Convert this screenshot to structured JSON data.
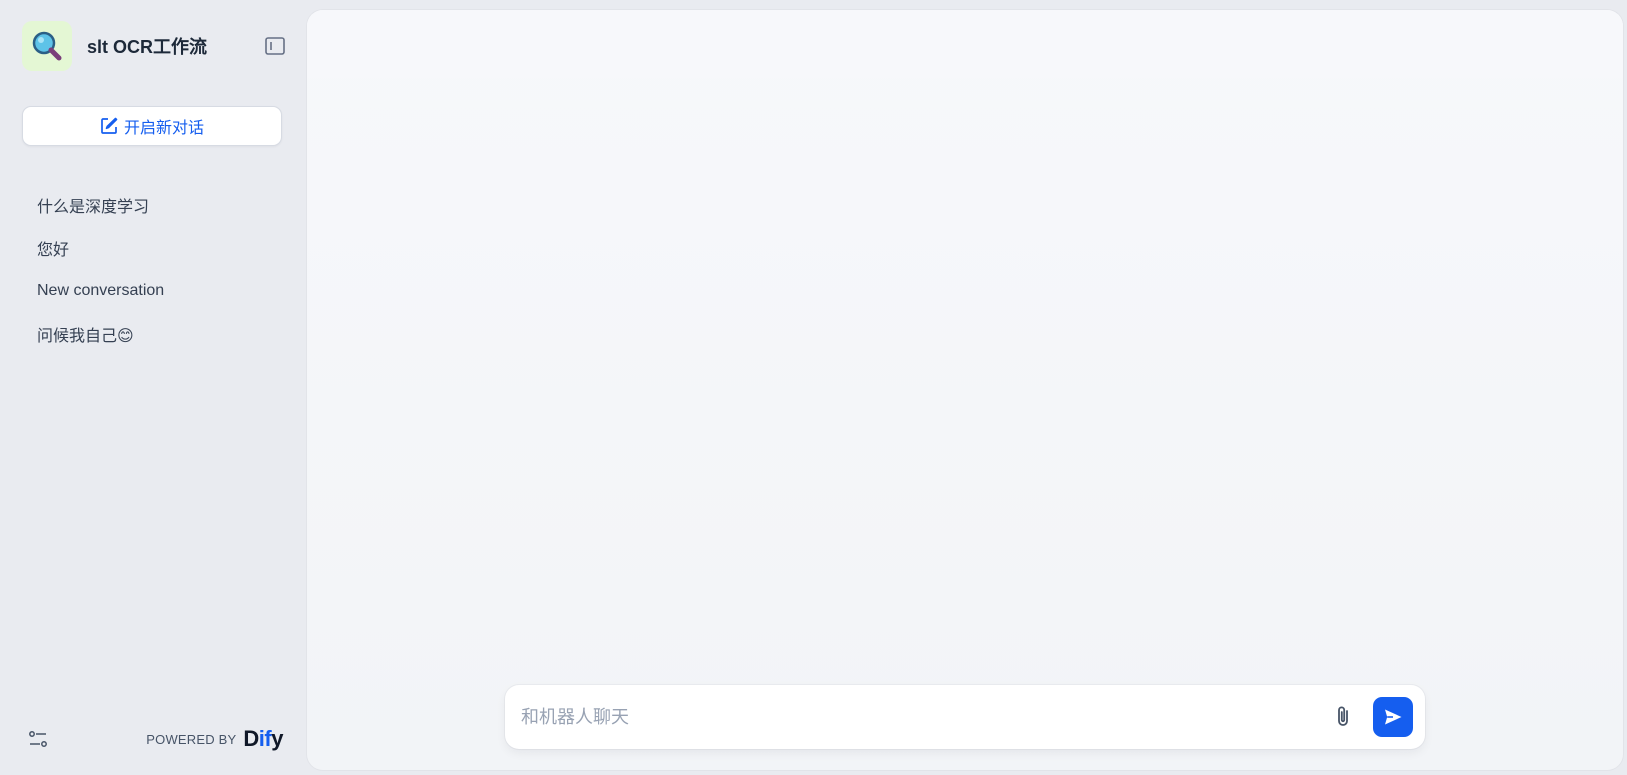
{
  "app": {
    "title": "slt OCR工作流",
    "icon": "magnifier-icon",
    "icon_bg": "#e4f7d4"
  },
  "sidebar": {
    "new_chat_label": "开启新对话",
    "conversations": [
      {
        "label": "什么是深度学习"
      },
      {
        "label": "您好"
      },
      {
        "label": "New conversation"
      },
      {
        "label": "问候我自己😊"
      }
    ],
    "footer": {
      "powered_by": "POWERED BY",
      "brand_prefix": "D",
      "brand_accent": "if",
      "brand_suffix": "y"
    }
  },
  "chat": {
    "input_placeholder": "和机器人聊天"
  },
  "colors": {
    "accent": "#155eef",
    "sidebar_bg": "#e9ebf0",
    "panel_bg": "#f2f4f7"
  }
}
